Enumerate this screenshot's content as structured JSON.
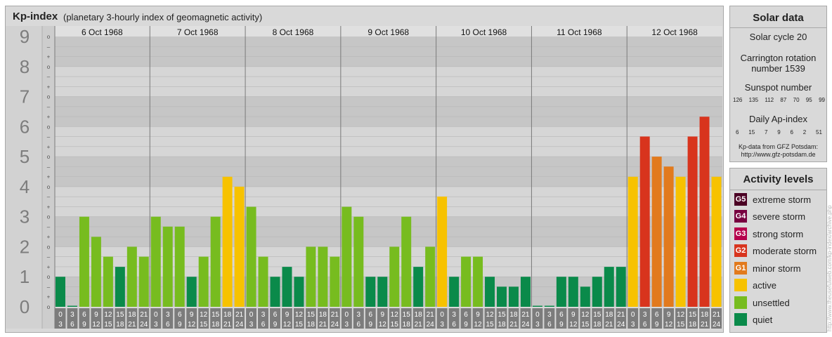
{
  "header": {
    "title": "Kp-index",
    "subtitle": "(planetary 3-hourly index of geomagnetic activity)"
  },
  "colors": {
    "quiet": "#0a8a4a",
    "unsettled": "#77bc1f",
    "active": "#f7c200",
    "minor_storm": "#e27a1d",
    "moderate_storm": "#d8341d",
    "strong_storm": "#b5004b",
    "severe_storm": "#77003f",
    "extreme_storm": "#4b0024"
  },
  "chart_data": {
    "type": "bar",
    "ylim": [
      0,
      9
    ],
    "y_ticks": [
      "0",
      "1",
      "2",
      "3",
      "4",
      "5",
      "6",
      "7",
      "8",
      "9"
    ],
    "y_minor_ticks": [
      "–",
      "o",
      "+"
    ],
    "days": [
      "6 Oct 1968",
      "7 Oct 1968",
      "8 Oct 1968",
      "9 Oct 1968",
      "10 Oct 1968",
      "11 Oct 1968",
      "12 Oct 1968"
    ],
    "slot_labels": [
      {
        "start": "0",
        "end": "3"
      },
      {
        "start": "3",
        "end": "6"
      },
      {
        "start": "6",
        "end": "9"
      },
      {
        "start": "9",
        "end": "12"
      },
      {
        "start": "12",
        "end": "15"
      },
      {
        "start": "15",
        "end": "18"
      },
      {
        "start": "18",
        "end": "21"
      },
      {
        "start": "21",
        "end": "24"
      }
    ],
    "values": [
      1.0,
      0.0,
      3.0,
      2.33,
      1.67,
      1.33,
      2.0,
      1.67,
      3.0,
      2.67,
      2.67,
      1.0,
      1.67,
      3.0,
      4.33,
      4.0,
      3.33,
      1.67,
      1.0,
      1.33,
      1.0,
      2.0,
      2.0,
      1.67,
      3.33,
      3.0,
      1.0,
      1.0,
      2.0,
      3.0,
      1.33,
      2.0,
      3.67,
      1.0,
      1.67,
      1.67,
      1.0,
      0.67,
      0.67,
      1.0,
      0.0,
      0.0,
      1.0,
      1.0,
      0.67,
      1.0,
      1.33,
      1.33,
      4.33,
      5.67,
      5.0,
      4.67,
      4.33,
      5.67,
      6.33,
      4.33
    ],
    "grid": true
  },
  "solar": {
    "title": "Solar data",
    "cycle": "Solar cycle 20",
    "carrington_line1": "Carrington rotation",
    "carrington_line2": "number 1539",
    "sunspot_label": "Sunspot number",
    "sunspot_values": [
      "126",
      "135",
      "112",
      "87",
      "70",
      "95",
      "99"
    ],
    "ap_label": "Daily Ap-index",
    "ap_values": [
      "6",
      "15",
      "7",
      "9",
      "6",
      "2",
      "51"
    ],
    "source_line1": "Kp-data from GFZ Potsdam:",
    "source_line2": "http://www.gfz-potsdam.de"
  },
  "activity": {
    "title": "Activity levels",
    "items": [
      {
        "badge": "G5",
        "label": "extreme storm",
        "color": "#4b0024"
      },
      {
        "badge": "G4",
        "label": "severe storm",
        "color": "#77003f"
      },
      {
        "badge": "G3",
        "label": "strong storm",
        "color": "#b5004b"
      },
      {
        "badge": "G2",
        "label": "moderate storm",
        "color": "#d8341d"
      },
      {
        "badge": "G1",
        "label": "minor storm",
        "color": "#e27a1d"
      },
      {
        "badge": "",
        "label": "active",
        "color": "#f7c200"
      },
      {
        "badge": "",
        "label": "unsettled",
        "color": "#77bc1f"
      },
      {
        "badge": "",
        "label": "quiet",
        "color": "#0a8a4a"
      }
    ]
  },
  "credit": "http://www.theusefulweb.com/kp-index/archive.php"
}
